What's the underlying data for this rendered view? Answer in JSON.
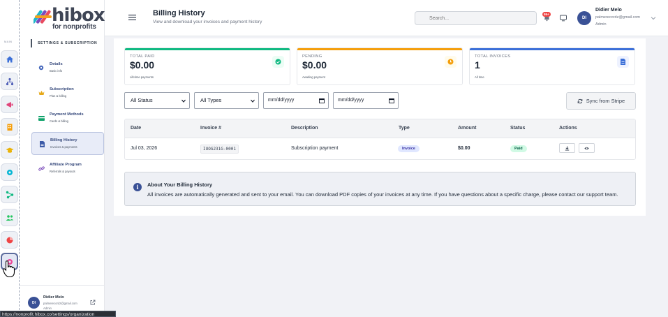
{
  "rail": {
    "label": "MAIN",
    "items": [
      {
        "icon": "home-icon",
        "color": "#3b6fd8"
      },
      {
        "icon": "org-chart-icon",
        "color": "#4b5bb5"
      },
      {
        "icon": "megaphone-icon",
        "color": "#e0447a"
      },
      {
        "icon": "building-icon",
        "color": "#f59e0b"
      },
      {
        "icon": "graduation-cap-icon",
        "color": "#eab308"
      },
      {
        "icon": "gear-icon",
        "color": "#06b6d4"
      },
      {
        "icon": "network-icon",
        "color": "#10b981"
      },
      {
        "icon": "users-icon",
        "color": "#22c55e"
      },
      {
        "icon": "pie-chart-icon",
        "color": "#ef4444"
      },
      {
        "icon": "settings-active-icon",
        "color": "#ec4899"
      }
    ]
  },
  "logo": {
    "brand": "hibox",
    "sub": "for nonprofits"
  },
  "sidebar": {
    "header": "SETTINGS & SUBSCRIPTION",
    "items": [
      {
        "title": "Details",
        "sub": "Basic info",
        "icon": "gear-icon",
        "color": "#4466bb"
      },
      {
        "title": "Subscription",
        "sub": "Plan & billing",
        "icon": "crown-icon",
        "color": "#e6a817"
      },
      {
        "title": "Payment Methods",
        "sub": "Cards & billing",
        "icon": "credit-card-icon",
        "color": "#10a36b"
      },
      {
        "title": "Billing History",
        "sub": "Invoices & payments",
        "icon": "document-icon",
        "color": "#3b5aa8"
      },
      {
        "title": "Affiliate Program",
        "sub": "Referrals & payouts",
        "icon": "link-icon",
        "color": "#7c4dbb"
      }
    ],
    "user": {
      "initials": "DI",
      "name": "Didier Melo",
      "email": "palmerecordz@gmail.com",
      "role": "Admin"
    }
  },
  "url_tooltip": "https://nonprofit.hibox.co/settings/organization",
  "header": {
    "title": "Billing History",
    "subtitle": "View and download your invoices and payment history",
    "search_placeholder": "Search...",
    "notif_badge": "99+",
    "user": {
      "initials": "DI",
      "name": "Didier Melo",
      "email": "palmerecordz@gmail.com",
      "role": "Admin"
    }
  },
  "stats": [
    {
      "label": "TOTAL PAID",
      "value": "$0.00",
      "caption": "Lifetime payments",
      "color": "#10b981",
      "icon": "check-circle-icon"
    },
    {
      "label": "PENDING",
      "value": "$0.00",
      "caption": "Awaiting payment",
      "color": "#f59e0b",
      "icon": "clock-icon"
    },
    {
      "label": "TOTAL INVOICES",
      "value": "1",
      "caption": "All time",
      "color": "#3b6fd8",
      "icon": "document-icon"
    }
  ],
  "filters": {
    "status": "All Status",
    "types": "All Types",
    "date_from": "mm/dd/yyyy",
    "date_to": "mm/dd/yyyy",
    "sync_label": "Sync from Stripe"
  },
  "table": {
    "headers": [
      "Date",
      "Invoice #",
      "Description",
      "Type",
      "Amount",
      "Status",
      "Actions"
    ],
    "rows": [
      {
        "date": "Jul 03, 2026",
        "invoice": "IUOG231G-0001",
        "description": "Subscription payment",
        "type": "Invoice",
        "amount": "$0.00",
        "status": "Paid"
      }
    ]
  },
  "info": {
    "title": "About Your Billing History",
    "text": "All invoices are automatically generated and sent to your email. You can download PDF copies of your invoices at any time. If you have questions about a specific charge, please contact our support team."
  }
}
